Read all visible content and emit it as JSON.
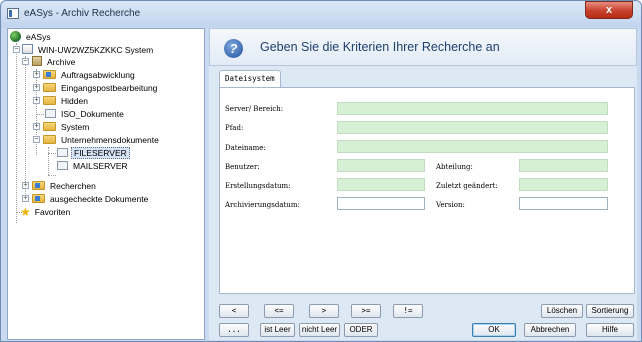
{
  "window": {
    "title": "eASys - Archiv Recherche",
    "close_label": "x"
  },
  "tree": {
    "root": "eASys",
    "system": "WIN-UW2WZ5KZKKC System",
    "archive": "Archive",
    "auftrag": "Auftragsabwicklung",
    "eingang": "Eingangspostbearbeitung",
    "hidden": "Hidden",
    "iso": "ISO_Dokumente",
    "sys": "System",
    "unternehmen": "Unternehmensdokumente",
    "fileserver": "FILESERVER",
    "mailserver": "MAILSERVER",
    "recherchen": "Recherchen",
    "ausgecheckt": "ausgecheckte Dokumente",
    "favoriten": "Favoriten"
  },
  "header": {
    "title": "Geben Sie die Kriterien Ihrer Recherche an"
  },
  "tabs": {
    "active": "Dateisystem"
  },
  "form": {
    "server_label": "Server/ Bereich:",
    "pfad_label": "Pfad:",
    "dateiname_label": "Dateiname:",
    "benutzer_label": "Benutzer:",
    "abteilung_label": "Abteilung:",
    "erstellungsdatum_label": "Erstellungsdatum:",
    "zuletzt_label": "Zuletzt geändert:",
    "archivierungsdatum_label": "Archivierungsdatum:",
    "version_label": "Version:",
    "server_value": "",
    "pfad_value": "",
    "dateiname_value": "",
    "benutzer_value": "",
    "abteilung_value": "",
    "erstellungsdatum_value": "",
    "zuletzt_value": "",
    "archivierungsdatum_value": "",
    "version_value": ""
  },
  "buttons": {
    "lt": "<",
    "le": "<=",
    "gt": ">",
    "ge": ">=",
    "ne": "!=",
    "loeschen": "Löschen",
    "sortierung": "Sortierung",
    "dots": "...",
    "ist_leer": "ist Leer",
    "nicht_leer": "nicht Leer",
    "oder": "ODER",
    "ok": "OK",
    "abbrechen": "Abbrechen",
    "hilfe": "Hilfe"
  }
}
